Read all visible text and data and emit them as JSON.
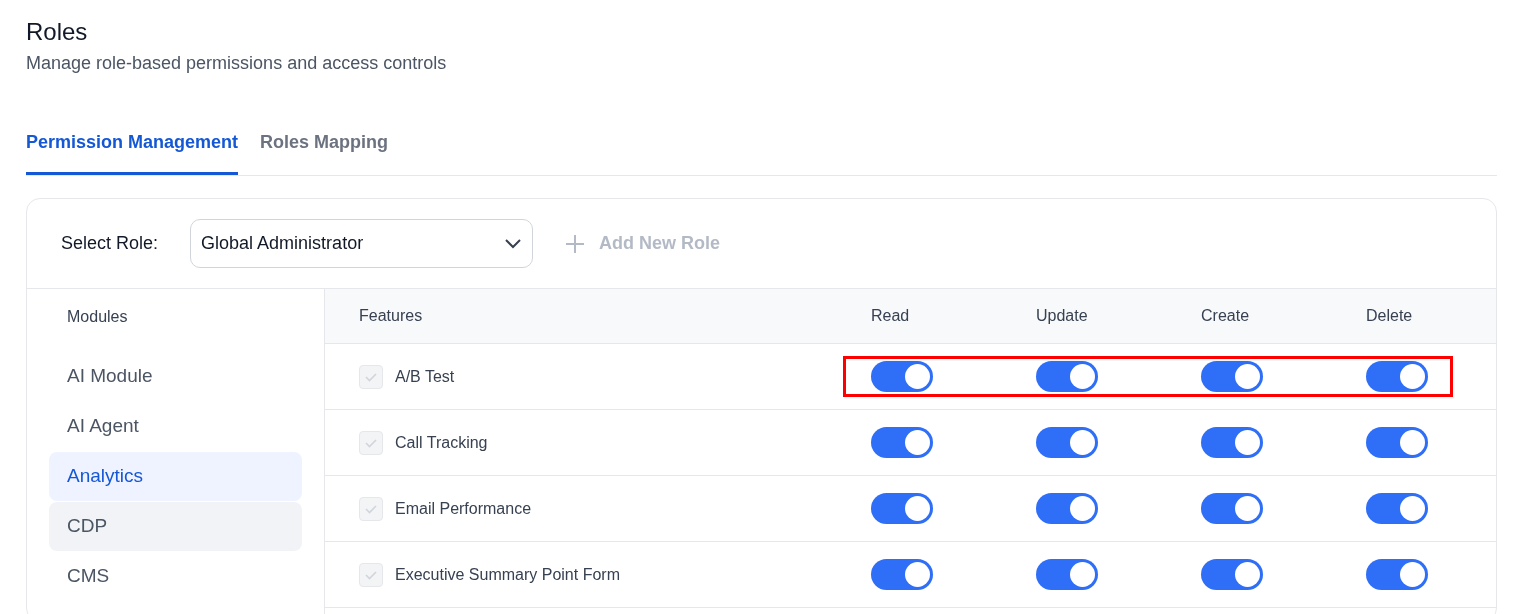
{
  "page": {
    "title": "Roles",
    "subtitle": "Manage role-based permissions and access controls"
  },
  "tabs": [
    {
      "label": "Permission Management",
      "selected": true
    },
    {
      "label": "Roles Mapping",
      "selected": false
    }
  ],
  "role_bar": {
    "label": "Select Role:",
    "selected_role": "Global Administrator",
    "add_button": {
      "label": "Add New Role",
      "disabled": true
    }
  },
  "modules": {
    "heading": "Modules",
    "items": [
      {
        "label": "AI Module",
        "selected": false,
        "hovered": false
      },
      {
        "label": "AI Agent",
        "selected": false,
        "hovered": false
      },
      {
        "label": "Analytics",
        "selected": true,
        "hovered": false
      },
      {
        "label": "CDP",
        "selected": false,
        "hovered": true
      },
      {
        "label": "CMS",
        "selected": false,
        "hovered": false
      }
    ]
  },
  "table": {
    "columns": [
      "Features",
      "Read",
      "Update",
      "Create",
      "Delete"
    ],
    "rows": [
      {
        "feature": "A/B Test",
        "checked": true,
        "disabled": true,
        "highlighted": true,
        "toggles": [
          {
            "on": true
          },
          {
            "on": true
          },
          {
            "on": true
          },
          {
            "on": true
          }
        ]
      },
      {
        "feature": "Call Tracking",
        "checked": true,
        "disabled": true,
        "highlighted": false,
        "toggles": [
          {
            "on": true
          },
          {
            "on": true
          },
          {
            "on": true
          },
          {
            "on": true
          }
        ]
      },
      {
        "feature": "Email Performance",
        "checked": true,
        "disabled": true,
        "highlighted": false,
        "toggles": [
          {
            "on": true
          },
          {
            "on": true
          },
          {
            "on": true
          },
          {
            "on": true
          }
        ]
      },
      {
        "feature": "Executive Summary Point Form",
        "checked": true,
        "disabled": true,
        "highlighted": false,
        "toggles": [
          {
            "on": true
          },
          {
            "on": true
          },
          {
            "on": true
          },
          {
            "on": true
          }
        ]
      }
    ]
  }
}
